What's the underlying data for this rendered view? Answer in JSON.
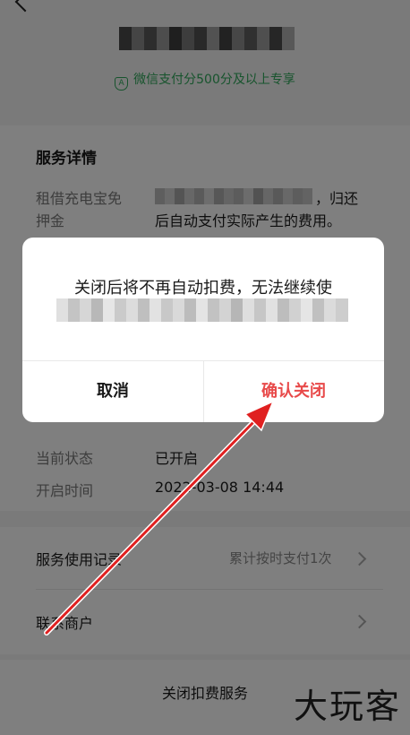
{
  "header": {
    "badge_text": "微信支付分500分及以上专享"
  },
  "service_details": {
    "section_title": "服务详情",
    "deposit_label": "租借充电宝免押金",
    "deposit_label_line1": "租借充电宝免",
    "deposit_label_line2": "押金",
    "deposit_value_tail": "，归还",
    "deposit_value_line2": "后自动支付实际产生的费用。"
  },
  "status": {
    "state_label": "当前状态",
    "state_value": "已开启",
    "time_label": "开启时间",
    "time_value": "2022-03-08 14:44"
  },
  "menu": {
    "usage_label": "服务使用记录",
    "usage_value": "累计按时支付1次",
    "contact_label": "联系商户"
  },
  "bottom": {
    "close_service_label": "关闭扣费服务"
  },
  "dialog": {
    "message": "关闭后将不再自动扣费，无法继续使",
    "cancel_label": "取消",
    "confirm_label": "确认关闭"
  },
  "watermark": "大玩客",
  "colors": {
    "accent_green": "#2fa85a",
    "confirm_red": "#e84a4a",
    "annotation_arrow": "#e02020"
  }
}
